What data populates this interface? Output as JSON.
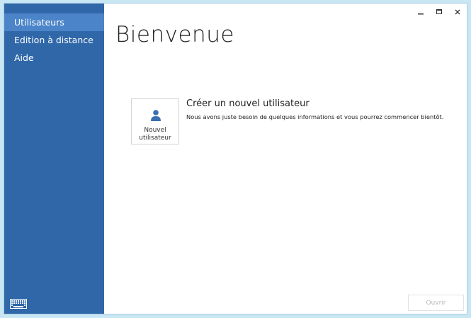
{
  "sidebar": {
    "items": [
      {
        "label": "Utilisateurs",
        "active": true
      },
      {
        "label": "Edition à distance",
        "active": false
      },
      {
        "label": "Aide",
        "active": false
      }
    ],
    "keyboard_icon": "keyboard-icon"
  },
  "window": {
    "controls": [
      "minimize-icon",
      "maximize-icon",
      "close-icon"
    ]
  },
  "main": {
    "title": "Bienvenue",
    "new_user_tile": {
      "label_line1": "Nouvel",
      "label_line2": "utilisateur",
      "icon": "user-icon"
    },
    "action": {
      "title": "Créer un nouvel utilisateur",
      "description": "Nous avons juste besoin de quelques informations et vous pourrez commencer bientôt."
    },
    "open_button": {
      "label": "Ouvrir",
      "enabled": false
    }
  },
  "colors": {
    "sidebar": "#2f67a9",
    "sidebar_active": "#4b84c8",
    "desktop": "#c8e6f3",
    "user_icon": "#3a6fb0"
  }
}
